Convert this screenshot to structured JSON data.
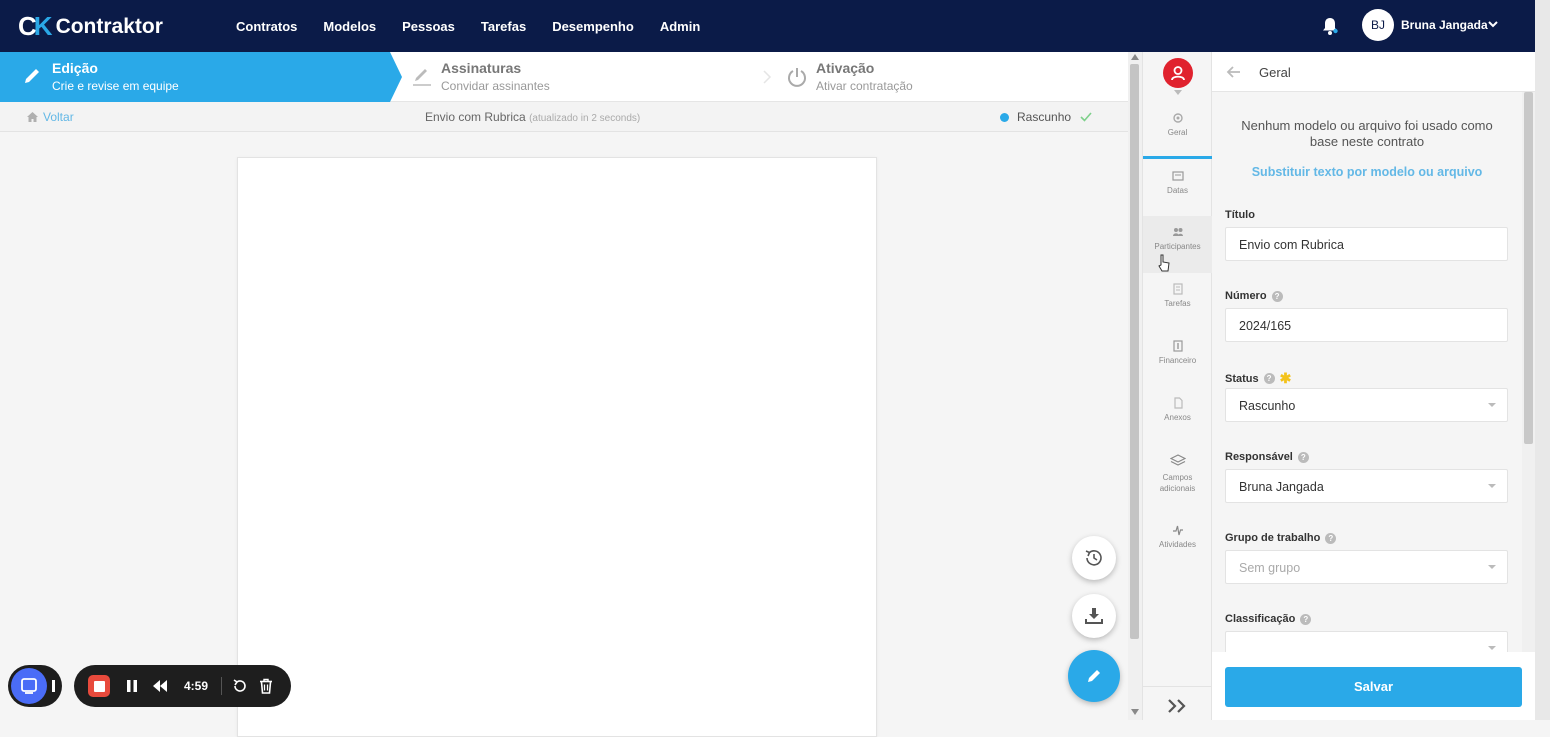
{
  "app": {
    "logo_mark": "CK",
    "logo_text": "Contraktor"
  },
  "nav": [
    "Contratos",
    "Modelos",
    "Pessoas",
    "Tarefas",
    "Desempenho",
    "Admin"
  ],
  "user": {
    "initials": "BJ",
    "name": "Bruna Jangada"
  },
  "steps": [
    {
      "title": "Edição",
      "subtitle": "Crie e revise em equipe",
      "active": true,
      "icon": "pencil-icon"
    },
    {
      "title": "Assinaturas",
      "subtitle": "Convidar assinantes",
      "active": false,
      "icon": "signature-icon"
    },
    {
      "title": "Ativação",
      "subtitle": "Ativar contratação",
      "active": false,
      "icon": "power-icon"
    }
  ],
  "subheader": {
    "back_label": "Voltar",
    "doc_title": "Envio com Rubrica",
    "updated": "(atualizado in 2 seconds)",
    "status": "Rascunho"
  },
  "recorder": {
    "time": "4:59"
  },
  "tabs": [
    {
      "label": "Geral",
      "icon": "gear-icon",
      "active": true
    },
    {
      "label": "Datas",
      "icon": "calendar-icon"
    },
    {
      "label": "Participantes",
      "icon": "people-icon",
      "hover": true
    },
    {
      "label": "Tarefas",
      "icon": "tasks-icon"
    },
    {
      "label": "Financeiro",
      "icon": "money-icon"
    },
    {
      "label": "Anexos",
      "icon": "file-icon"
    },
    {
      "label": "Campos adicionais",
      "icon": "layers-icon"
    },
    {
      "label": "Atividades",
      "icon": "activity-icon"
    }
  ],
  "panel": {
    "title": "Geral",
    "no_model_text": "Nenhum modelo ou arquivo foi usado como base neste contrato",
    "replace_link": "Substituir texto por modelo ou arquivo",
    "fields": {
      "titulo": {
        "label": "Título",
        "value": "Envio com Rubrica"
      },
      "numero": {
        "label": "Número",
        "value": "2024/165"
      },
      "status": {
        "label": "Status",
        "value": "Rascunho"
      },
      "responsavel": {
        "label": "Responsável",
        "value": "Bruna Jangada"
      },
      "grupo": {
        "label": "Grupo de trabalho",
        "placeholder": "Sem grupo"
      },
      "classificacao": {
        "label": "Classificação",
        "value": ""
      }
    },
    "save_label": "Salvar"
  },
  "colors": {
    "navbar": "#0b1b48",
    "accent": "#2aa9e8",
    "user_red": "#e0222e",
    "record_red": "#e84a3c"
  }
}
